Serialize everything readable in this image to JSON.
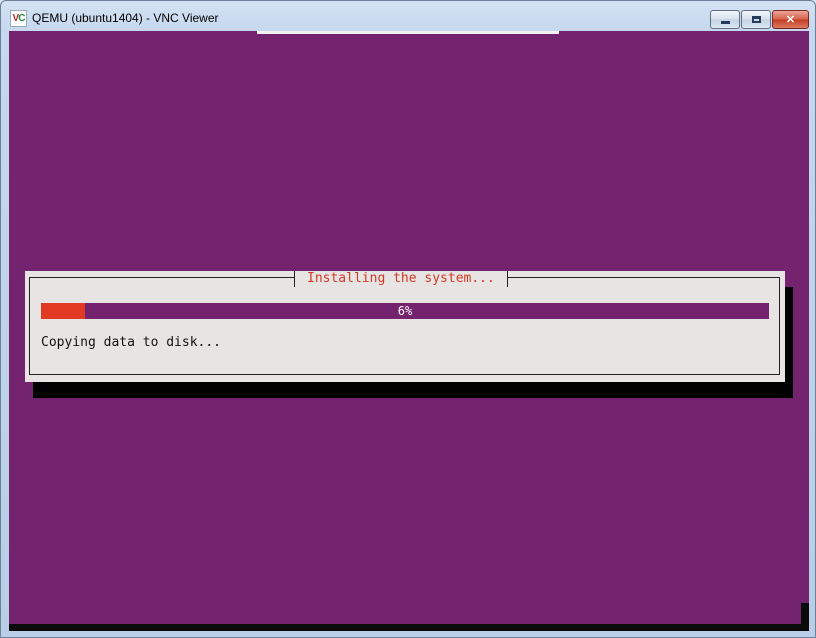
{
  "window": {
    "title": "QEMU (ubuntu1404) - VNC Viewer",
    "icon_letters": {
      "first": "V",
      "second": "C"
    },
    "controls": {
      "minimize": "minimize-icon",
      "maximize": "maximize-icon",
      "close": "✕"
    }
  },
  "installer": {
    "dialog_title": "Installing the system...",
    "progress": {
      "percent": 6,
      "label": "6%"
    },
    "status": "Copying data to disk..."
  },
  "colors": {
    "desktop_background": "#74246e",
    "dialog_background": "#e8e4e4",
    "progress_fill": "#e03a22",
    "title_text": "#d33a25"
  }
}
